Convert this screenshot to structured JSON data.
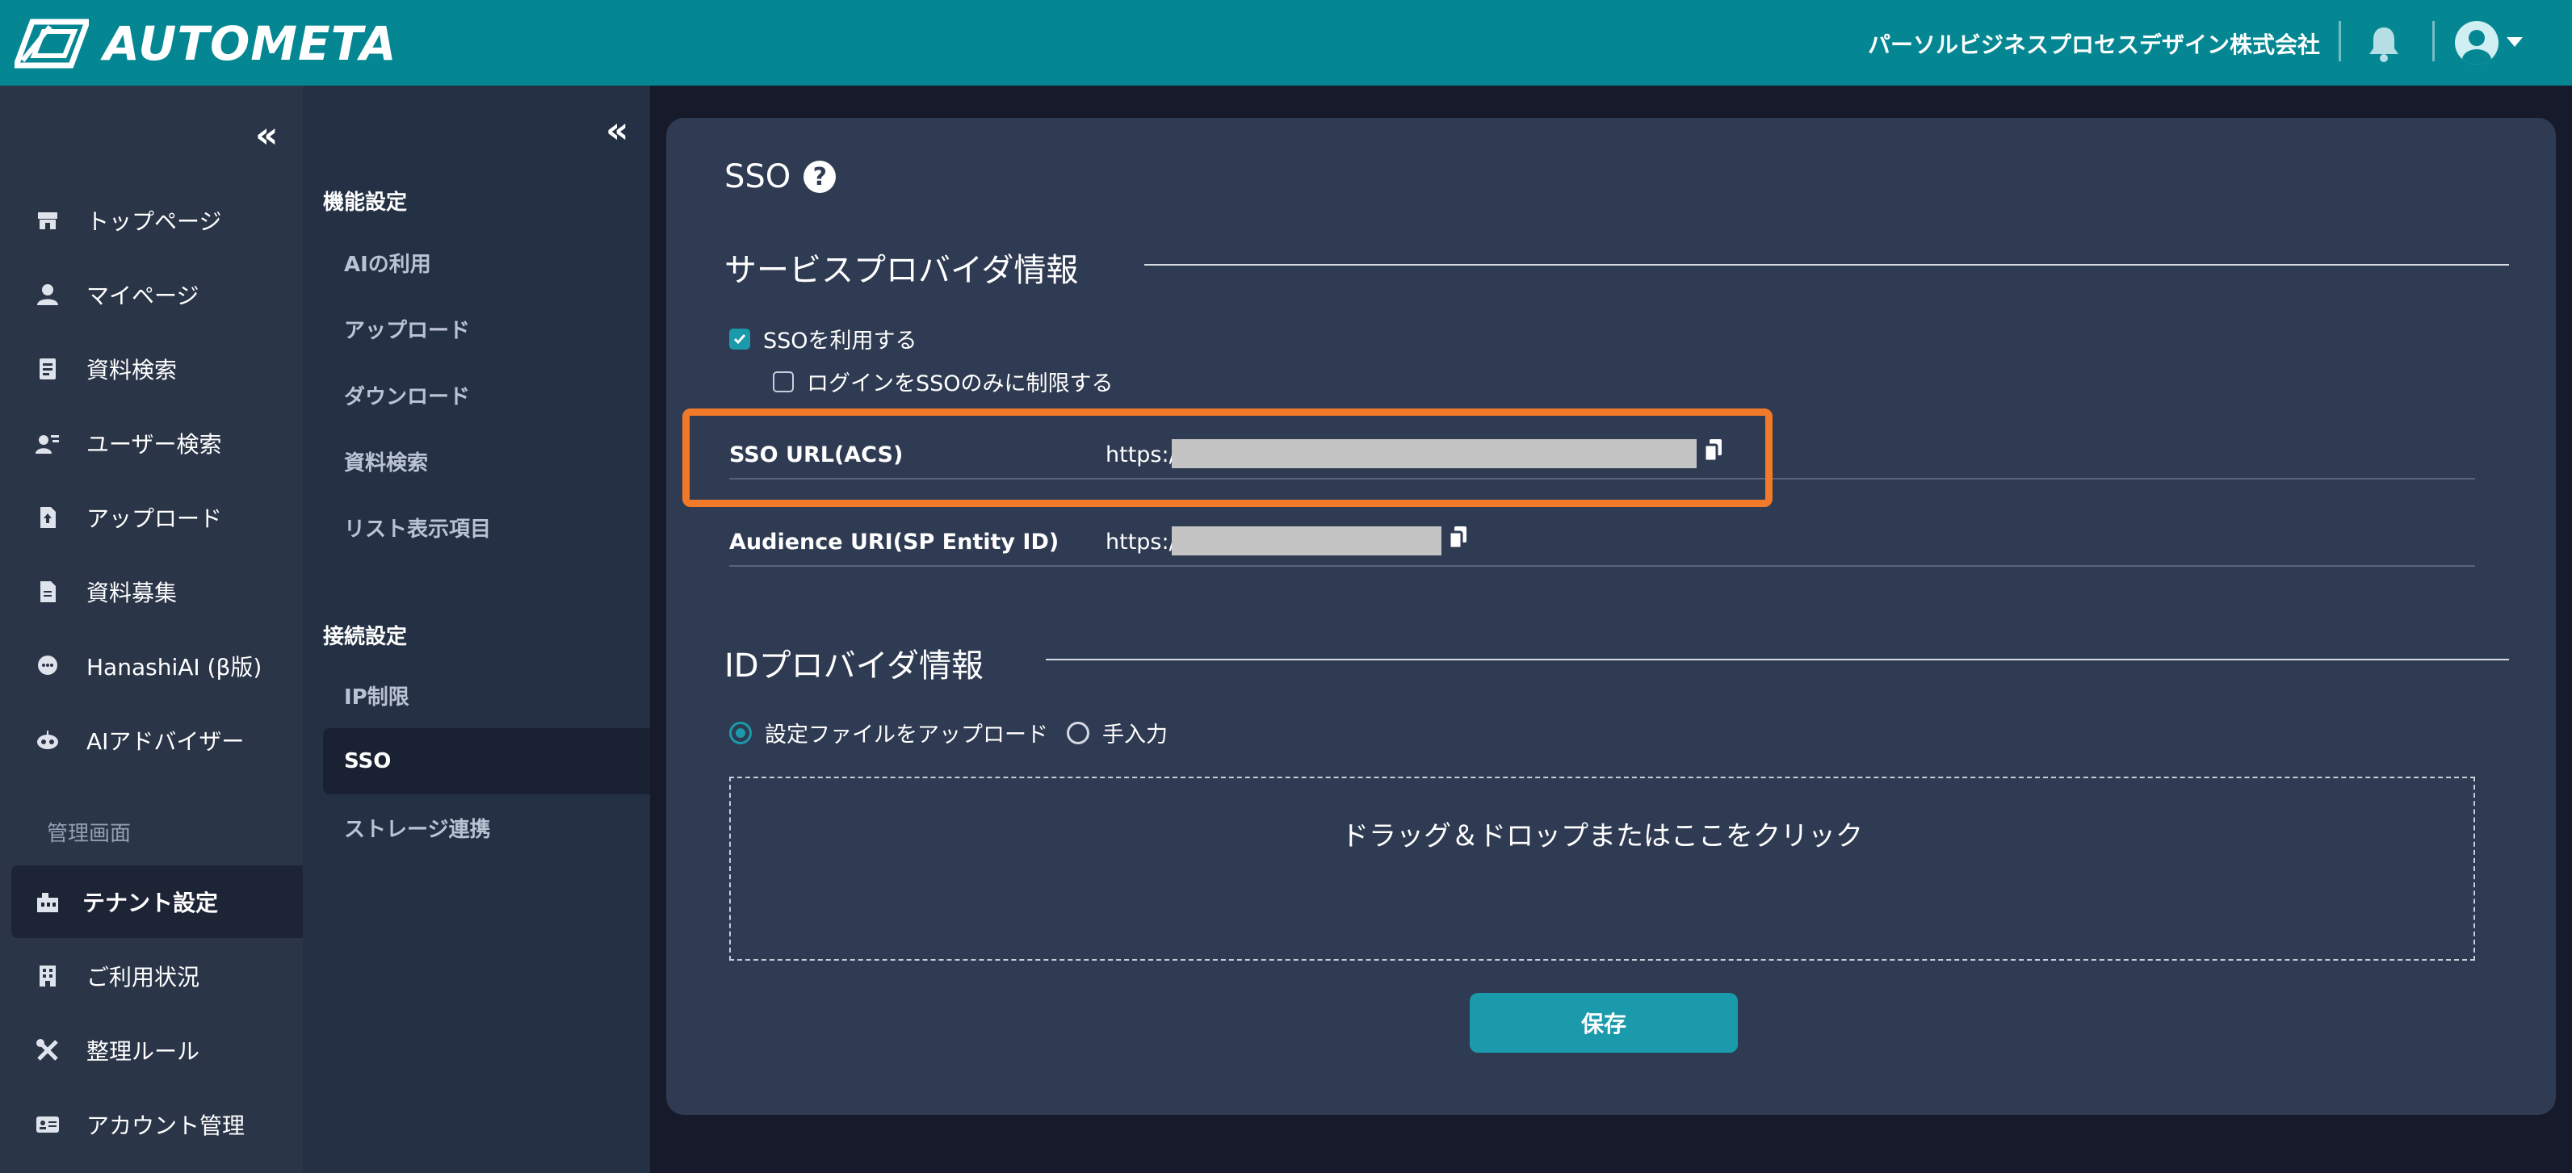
{
  "header": {
    "app_name": "AUTOMETA",
    "company": "パーソルビジネスプロセスデザイン株式会社"
  },
  "leftnav": {
    "collapse": "«",
    "items": [
      {
        "label": "トップページ",
        "icon": "home-icon"
      },
      {
        "label": "マイページ",
        "icon": "user-icon"
      },
      {
        "label": "資料検索",
        "icon": "document-search-icon"
      },
      {
        "label": "ユーザー検索",
        "icon": "user-search-icon"
      },
      {
        "label": "アップロード",
        "icon": "file-upload-icon"
      },
      {
        "label": "資料募集",
        "icon": "file-icon"
      },
      {
        "label": "HanashiAI (β版)",
        "icon": "chat-icon"
      },
      {
        "label": "AIアドバイザー",
        "icon": "robot-icon"
      }
    ],
    "admin_section": "管理画面",
    "admin_items": [
      {
        "label": "テナント設定",
        "icon": "building-icon",
        "active": true
      },
      {
        "label": "ご利用状況",
        "icon": "office-icon"
      },
      {
        "label": "整理ルール",
        "icon": "tools-icon"
      },
      {
        "label": "アカウント管理",
        "icon": "id-card-icon"
      }
    ]
  },
  "subnav": {
    "collapse": "«",
    "groups": [
      {
        "title": "機能設定",
        "items": [
          "AIの利用",
          "アップロード",
          "ダウンロード",
          "資料検索",
          "リスト表示項目"
        ]
      },
      {
        "title": "接続設定",
        "items": [
          "IP制限",
          "SSO",
          "ストレージ連携"
        ]
      }
    ],
    "active": "SSO"
  },
  "main": {
    "title": "SSO",
    "help": "?",
    "sp_section": "サービスプロバイダ情報",
    "use_sso": {
      "label": "SSOを利用する",
      "checked": true
    },
    "restrict_login": {
      "label": "ログインをSSOのみに制限する",
      "checked": false
    },
    "rows": [
      {
        "key": "SSO URL(ACS)",
        "value": "https://"
      },
      {
        "key": "Audience URI(SP Entity ID)",
        "value": "https://"
      }
    ],
    "idp_section": "IDプロバイダ情報",
    "radio_upload": {
      "label": "設定ファイルをアップロード",
      "selected": true
    },
    "radio_manual": {
      "label": "手入力",
      "selected": false
    },
    "dropzone": "ドラッグ＆ドロップまたはここをクリック",
    "save": "保存"
  },
  "colors": {
    "header": "#058793",
    "accent": "#1a9aab",
    "highlight": "#f07a2a",
    "panel": "#2f3b52"
  }
}
